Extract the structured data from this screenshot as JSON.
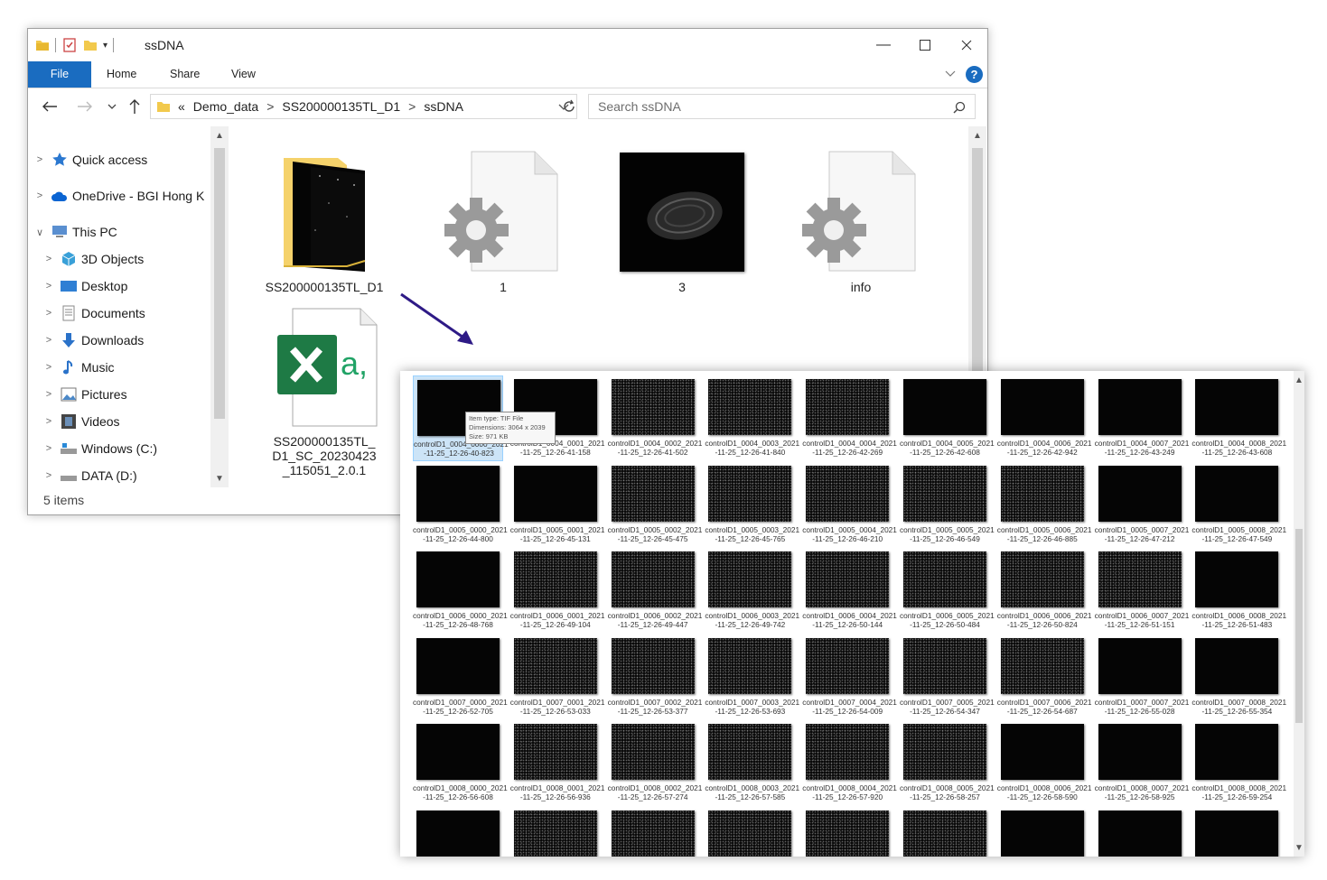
{
  "window": {
    "title": "ssDNA",
    "ribbon_tabs": [
      "File",
      "Home",
      "Share",
      "View"
    ],
    "help_label": "?"
  },
  "address": {
    "prefix": "«",
    "crumbs": [
      "Demo_data",
      "SS200000135TL_D1",
      "ssDNA"
    ],
    "separator": ">"
  },
  "search": {
    "placeholder": "Search ssDNA"
  },
  "nav_pane": {
    "items": [
      {
        "label": "Quick access",
        "icon": "star-icon",
        "color": "#2b78d0"
      },
      {
        "label": "OneDrive - BGI Hong K",
        "icon": "cloud-icon",
        "color": "#0a64d2"
      },
      {
        "label": "This PC",
        "icon": "computer-icon",
        "color": "#5a8fd0"
      },
      {
        "label": "3D Objects",
        "icon": "cube-icon",
        "color": "#39a0d8"
      },
      {
        "label": "Desktop",
        "icon": "desktop-icon",
        "color": "#2f7fd4"
      },
      {
        "label": "Documents",
        "icon": "document-icon",
        "color": "#888888"
      },
      {
        "label": "Downloads",
        "icon": "download-icon",
        "color": "#2a72c9"
      },
      {
        "label": "Music",
        "icon": "music-icon",
        "color": "#2a72c9"
      },
      {
        "label": "Pictures",
        "icon": "picture-icon",
        "color": "#4b88c8"
      },
      {
        "label": "Videos",
        "icon": "video-icon",
        "color": "#444444"
      },
      {
        "label": "Windows (C:)",
        "icon": "drive-icon",
        "color": "#777777"
      },
      {
        "label": "DATA (D:)",
        "icon": "drive-icon",
        "color": "#777777"
      }
    ]
  },
  "files": [
    {
      "name": "SS200000135TL_D1",
      "icon": "folder-icon"
    },
    {
      "name": "1",
      "icon": "settings-file-icon"
    },
    {
      "name": "3",
      "icon": "image-thumbnail-icon"
    },
    {
      "name": "info",
      "icon": "settings-file-icon"
    },
    {
      "name": "SS200000135TL_D1_SC_20230423_115051_2.0.1",
      "icon": "excel-file-icon"
    }
  ],
  "status": {
    "items": "5 items"
  },
  "tooltip": {
    "type": "Item type: TIF File",
    "dimensions": "Dimensions: 3064 x 2039",
    "size": "Size: 971 KB"
  },
  "tiles": [
    [
      "controlD1_0004_0000_2021-11-25_12-26-40-823",
      "controlD1_0004_0001_2021-11-25_12-26-41-158",
      "controlD1_0004_0002_2021-11-25_12-26-41-502",
      "controlD1_0004_0003_2021-11-25_12-26-41-840",
      "controlD1_0004_0004_2021-11-25_12-26-42-269",
      "controlD1_0004_0005_2021-11-25_12-26-42-608",
      "controlD1_0004_0006_2021-11-25_12-26-42-942",
      "controlD1_0004_0007_2021-11-25_12-26-43-249",
      "controlD1_0004_0008_2021-11-25_12-26-43-608"
    ],
    [
      "controlD1_0005_0000_2021-11-25_12-26-44-800",
      "controlD1_0005_0001_2021-11-25_12-26-45-131",
      "controlD1_0005_0002_2021-11-25_12-26-45-475",
      "controlD1_0005_0003_2021-11-25_12-26-45-765",
      "controlD1_0005_0004_2021-11-25_12-26-46-210",
      "controlD1_0005_0005_2021-11-25_12-26-46-549",
      "controlD1_0005_0006_2021-11-25_12-26-46-885",
      "controlD1_0005_0007_2021-11-25_12-26-47-212",
      "controlD1_0005_0008_2021-11-25_12-26-47-549"
    ],
    [
      "controlD1_0006_0000_2021-11-25_12-26-48-768",
      "controlD1_0006_0001_2021-11-25_12-26-49-104",
      "controlD1_0006_0002_2021-11-25_12-26-49-447",
      "controlD1_0006_0003_2021-11-25_12-26-49-742",
      "controlD1_0006_0004_2021-11-25_12-26-50-144",
      "controlD1_0006_0005_2021-11-25_12-26-50-484",
      "controlD1_0006_0006_2021-11-25_12-26-50-824",
      "controlD1_0006_0007_2021-11-25_12-26-51-151",
      "controlD1_0006_0008_2021-11-25_12-26-51-483"
    ],
    [
      "controlD1_0007_0000_2021-11-25_12-26-52-705",
      "controlD1_0007_0001_2021-11-25_12-26-53-033",
      "controlD1_0007_0002_2021-11-25_12-26-53-377",
      "controlD1_0007_0003_2021-11-25_12-26-53-693",
      "controlD1_0007_0004_2021-11-25_12-26-54-009",
      "controlD1_0007_0005_2021-11-25_12-26-54-347",
      "controlD1_0007_0006_2021-11-25_12-26-54-687",
      "controlD1_0007_0007_2021-11-25_12-26-55-028",
      "controlD1_0007_0008_2021-11-25_12-26-55-354"
    ],
    [
      "controlD1_0008_0000_2021-11-25_12-26-56-608",
      "controlD1_0008_0001_2021-11-25_12-26-56-936",
      "controlD1_0008_0002_2021-11-25_12-26-57-274",
      "controlD1_0008_0003_2021-11-25_12-26-57-585",
      "controlD1_0008_0004_2021-11-25_12-26-57-920",
      "controlD1_0008_0005_2021-11-25_12-26-58-257",
      "controlD1_0008_0006_2021-11-25_12-26-58-590",
      "controlD1_0008_0007_2021-11-25_12-26-58-925",
      "controlD1_0008_0008_2021-11-25_12-26-59-254"
    ],
    [
      "",
      "",
      "",
      "",
      "",
      "",
      "",
      "",
      ""
    ]
  ],
  "tile_textured": [
    [
      0,
      0,
      1,
      1,
      1,
      0,
      0,
      0,
      0
    ],
    [
      0,
      0,
      1,
      1,
      1,
      1,
      1,
      0,
      0
    ],
    [
      0,
      1,
      1,
      1,
      1,
      1,
      1,
      1,
      0
    ],
    [
      0,
      1,
      1,
      1,
      1,
      1,
      1,
      0,
      0
    ],
    [
      0,
      1,
      1,
      1,
      1,
      1,
      0,
      0,
      0
    ],
    [
      0,
      1,
      1,
      1,
      1,
      1,
      0,
      0,
      0
    ]
  ],
  "colors": {
    "accent": "#1a6cc0",
    "arrow": "#2e1a86",
    "selection": "#cce4f7"
  }
}
